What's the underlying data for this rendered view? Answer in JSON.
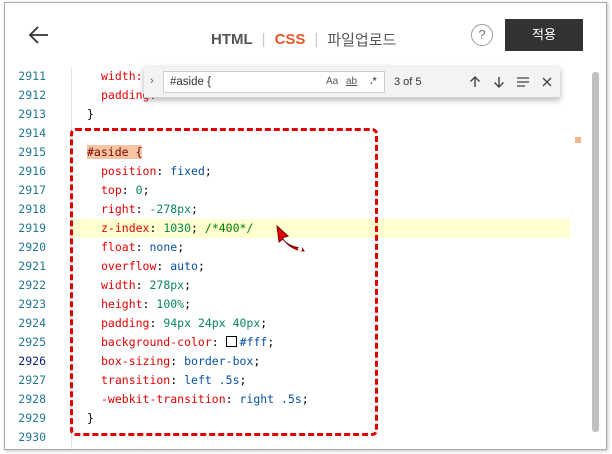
{
  "header": {
    "tabs": [
      {
        "label": "HTML"
      },
      {
        "label": "CSS"
      },
      {
        "label": "파일업로드"
      }
    ],
    "help_label": "?",
    "apply_label": "적용"
  },
  "editor": {
    "line_numbers": [
      "2911",
      "2912",
      "2913",
      "2914",
      "2915",
      "2916",
      "2917",
      "2918",
      "2919",
      "2920",
      "2921",
      "2922",
      "2923",
      "2924",
      "2925",
      "2926",
      "2927",
      "2928",
      "2929",
      "2930"
    ],
    "lines": {
      "l2911": {
        "prop": "width:"
      },
      "l2912": {
        "prop": "padding:"
      },
      "l2913": {
        "text": "}"
      },
      "l2915": {
        "selector": "#aside",
        "brace": " {"
      },
      "l2916": {
        "prop": "position",
        "colon": ": ",
        "val": "fixed",
        "semi": ";"
      },
      "l2917": {
        "prop": "top",
        "colon": ": ",
        "val": "0",
        "semi": ";"
      },
      "l2918": {
        "prop": "right",
        "colon": ": ",
        "val": "-278px",
        "semi": ";"
      },
      "l2919": {
        "prop": "z-index",
        "colon": ": ",
        "val": "1030",
        "semi": "; ",
        "comment": "/*400*/"
      },
      "l2920": {
        "prop": "float",
        "colon": ": ",
        "val": "none",
        "semi": ";"
      },
      "l2921": {
        "prop": "overflow",
        "colon": ": ",
        "val": "auto",
        "semi": ";"
      },
      "l2922": {
        "prop": "width",
        "colon": ": ",
        "val": "278px",
        "semi": ";"
      },
      "l2923": {
        "prop": "height",
        "colon": ": ",
        "val": "100%",
        "semi": ";"
      },
      "l2924": {
        "prop": "padding",
        "colon": ": ",
        "val": "94px 24px 40px",
        "semi": ";"
      },
      "l2925": {
        "prop": "background-color",
        "colon": ": ",
        "val": "#fff",
        "semi": ";"
      },
      "l2926": {
        "prop": "box-sizing",
        "colon": ": ",
        "val": "border-box",
        "semi": ";"
      },
      "l2927": {
        "prop": "transition",
        "colon": ": ",
        "val": "left .5s",
        "semi": ";"
      },
      "l2928": {
        "prop": "-webkit-transition",
        "colon": ": ",
        "val": "right .5s",
        "semi": ";"
      },
      "l2929": {
        "text": "}"
      }
    }
  },
  "find": {
    "value": "#aside {",
    "match_case": "Aa",
    "whole_word": "ab",
    "regex": ".*",
    "count": "3 of 5"
  },
  "colors": {
    "accent": "#e8572a",
    "annotation": "#e00000",
    "apply_bg": "#333333"
  },
  "icons": [
    "back-arrow-icon",
    "help-icon",
    "chevron-right-icon",
    "arrow-up-icon",
    "arrow-down-icon",
    "find-in-selection-icon",
    "close-icon",
    "hand-pointer-icon"
  ]
}
